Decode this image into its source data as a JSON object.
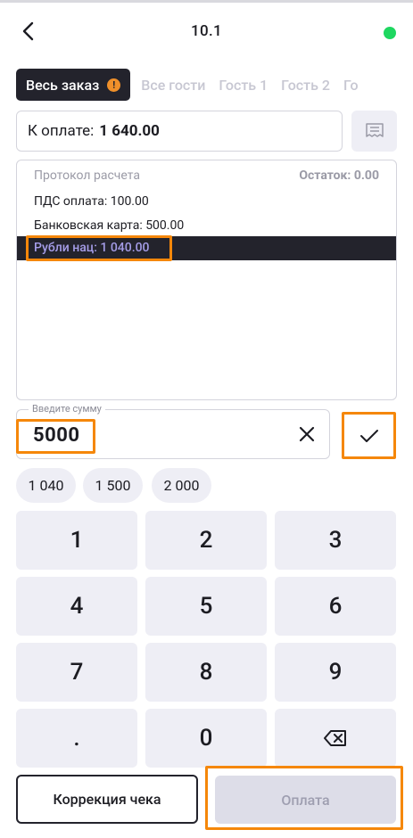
{
  "header": {
    "title": "10.1",
    "status_color": "#1ed760"
  },
  "tabs": [
    {
      "label": "Весь заказ",
      "active": true,
      "badge": "!"
    },
    {
      "label": "Все гости",
      "active": false
    },
    {
      "label": "Гость 1",
      "active": false
    },
    {
      "label": "Гость 2",
      "active": false
    },
    {
      "label": "Го",
      "active": false
    }
  ],
  "amount": {
    "label": "К оплате:",
    "value": "1 640.00"
  },
  "protocol": {
    "title": "Протокол расчета",
    "remainder": "Остаток: 0.00",
    "rows": [
      "ПДС оплата: 100.00",
      "Банковская карта: 500.00",
      "Рубли нац: 1 040.00"
    ]
  },
  "input": {
    "label": "Введите сумму",
    "value": "5000"
  },
  "quick_amounts": [
    "1 040",
    "1 500",
    "2 000"
  ],
  "keypad": [
    "1",
    "2",
    "3",
    "4",
    "5",
    "6",
    "7",
    "8",
    "9",
    ".",
    "0"
  ],
  "buttons": {
    "correction": "Коррекция чека",
    "pay": "Оплата"
  },
  "colors": {
    "accent_highlight": "#f5870a",
    "dark": "#23232c",
    "selected_text": "#a59de8",
    "key_bg": "#eeeef5"
  },
  "icons": {
    "back": "chevron-left-icon",
    "receipt": "receipt-icon",
    "clear": "close-icon",
    "confirm": "check-icon",
    "backspace": "backspace-icon"
  }
}
